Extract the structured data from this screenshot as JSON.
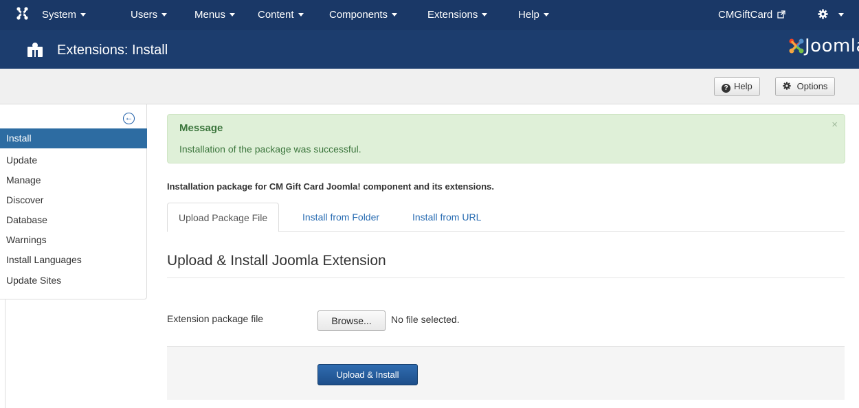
{
  "navbar": {
    "menus": [
      {
        "label": "System"
      },
      {
        "label": "Users"
      },
      {
        "label": "Menus"
      },
      {
        "label": "Content"
      },
      {
        "label": "Components"
      },
      {
        "label": "Extensions"
      },
      {
        "label": "Help"
      }
    ],
    "site_link": "CMGiftCard",
    "settings_icon": "gear-icon"
  },
  "header": {
    "title": "Extensions: Install",
    "icon": "puzzle-icon",
    "brand": "Joomla!"
  },
  "toolbar": {
    "help_label": "Help",
    "options_label": "Options"
  },
  "sidebar": {
    "items": [
      {
        "label": "Install",
        "active": true
      },
      {
        "label": "Update"
      },
      {
        "label": "Manage"
      },
      {
        "label": "Discover"
      },
      {
        "label": "Database"
      },
      {
        "label": "Warnings"
      },
      {
        "label": "Install Languages"
      },
      {
        "label": "Update Sites"
      }
    ]
  },
  "message": {
    "title": "Message",
    "text": "Installation of the package was successful.",
    "close": "×"
  },
  "package_description": "Installation package for CM Gift Card Joomla! component and its extensions.",
  "tabs": [
    {
      "label": "Upload Package File",
      "active": true
    },
    {
      "label": "Install from Folder"
    },
    {
      "label": "Install from URL"
    }
  ],
  "section": {
    "title": "Upload & Install Joomla Extension",
    "field_label": "Extension package file",
    "browse_label": "Browse...",
    "file_status": "No file selected.",
    "submit_label": "Upload & Install"
  },
  "colors": {
    "navbar": "#1a3867",
    "header": "#1c3d6e",
    "active_item": "#2d6ca2",
    "success_bg": "#dff0d8",
    "success_text": "#3c763d",
    "link": "#2a6db3"
  }
}
